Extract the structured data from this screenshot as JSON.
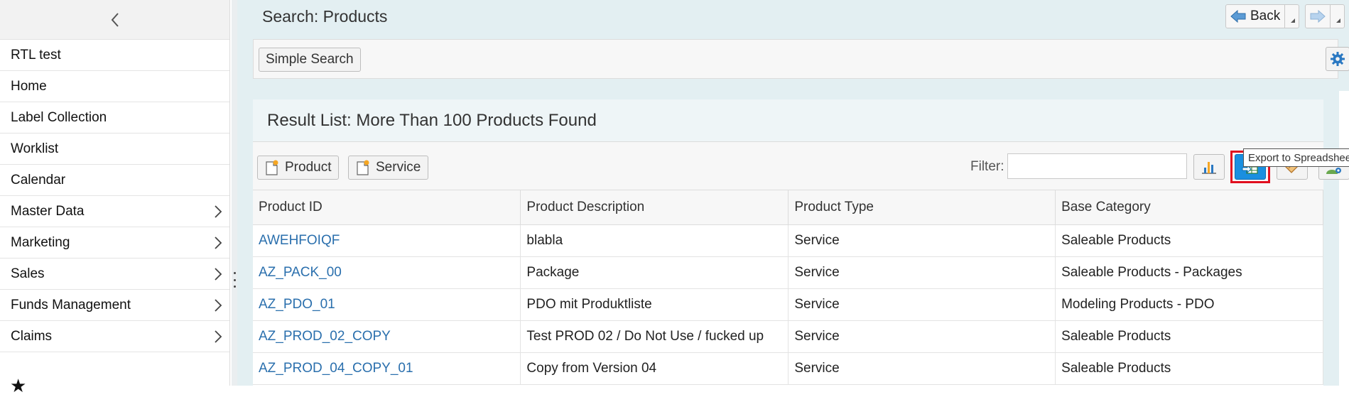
{
  "sidebar": {
    "items": [
      {
        "label": "RTL test",
        "has_children": false
      },
      {
        "label": "Home",
        "has_children": false
      },
      {
        "label": "Label Collection",
        "has_children": false
      },
      {
        "label": "Worklist",
        "has_children": false
      },
      {
        "label": "Calendar",
        "has_children": false
      },
      {
        "label": "Master Data",
        "has_children": true
      },
      {
        "label": "Marketing",
        "has_children": true
      },
      {
        "label": "Sales",
        "has_children": true
      },
      {
        "label": "Funds Management",
        "has_children": true
      },
      {
        "label": "Claims",
        "has_children": true
      }
    ],
    "favorite_icon": "star-icon"
  },
  "header": {
    "title": "Search: Products",
    "back_label": "Back"
  },
  "search": {
    "simple_search_label": "Simple Search"
  },
  "results": {
    "title": "Result List: More Than 100 Products Found",
    "new_product_label": "Product",
    "new_service_label": "Service",
    "filter_label": "Filter:",
    "filter_value": "",
    "export_tooltip": "Export to Spreadsheet",
    "columns": [
      "Product ID",
      "Product Description",
      "Product Type",
      "Base Category"
    ],
    "rows": [
      [
        "AWEHFOIQF",
        "blabla",
        "Service",
        "Saleable Products"
      ],
      [
        "AZ_PACK_00",
        "Package",
        "Service",
        "Saleable Products - Packages"
      ],
      [
        "AZ_PDO_01",
        "PDO mit Produktliste",
        "Service",
        "Modeling Products - PDO"
      ],
      [
        "AZ_PROD_02_COPY",
        "Test PROD 02 / Do Not Use / fucked up",
        "Service",
        "Saleable Products"
      ],
      [
        "AZ_PROD_04_COPY_01",
        "Copy from Version 04",
        "Service",
        "Saleable Products"
      ]
    ]
  },
  "colors": {
    "main_bg": "#e3eff2",
    "link": "#2a6fad",
    "export_active": "#1a8fe0",
    "highlight": "#e10f1f"
  }
}
